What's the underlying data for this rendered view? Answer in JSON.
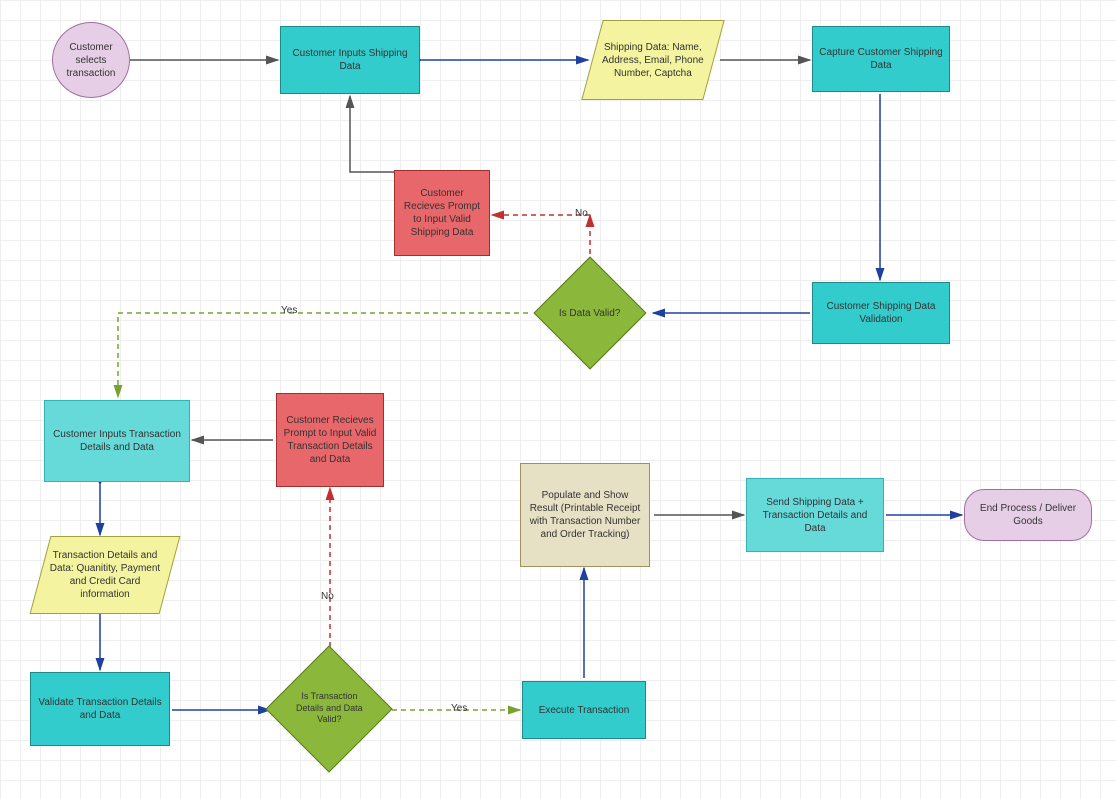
{
  "nodes": {
    "start": "Customer selects transaction",
    "inputShipping": "Customer Inputs Shipping Data",
    "shippingData": "Shipping Data: Name, Address, Email,  Phone Number, Captcha",
    "captureShipping": "Capture Customer Shipping Data",
    "validShippingPrompt": "Customer Recieves Prompt to Input Valid Shipping Data",
    "shippingValidation": "Customer Shipping Data Validation",
    "isDataValid": "Is Data Valid?",
    "inputTransaction": "Customer Inputs Transaction Details and Data",
    "validTxPrompt": "Customer Recieves Prompt to Input Valid Transaction Details and Data",
    "txDetails": "Transaction Details and Data: Quanitity, Payment  and Credit Card information",
    "validateTx": "Validate Transaction Details and Data",
    "isTxValid": "Is Transaction Details  and Data Valid?",
    "execute": "Execute Transaction",
    "populate": "Populate and Show Result (Printable Receipt with Transaction Number and Order Tracking)",
    "sendData": "Send Shipping Data + Transaction Details and Data",
    "end": "End Process / Deliver Goods"
  },
  "labels": {
    "yes": "Yes",
    "no": "No"
  }
}
